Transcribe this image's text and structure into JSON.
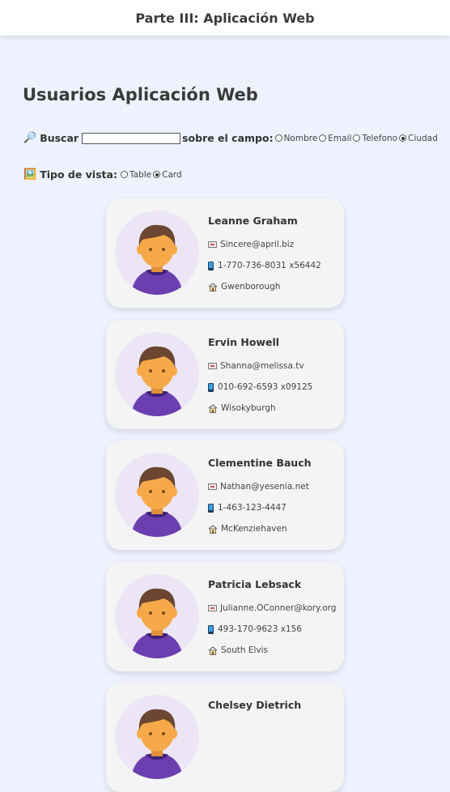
{
  "header": {
    "title": "Parte III: Aplicación Web"
  },
  "main": {
    "title": "Usuarios Aplicación Web"
  },
  "search": {
    "icon": "magnifier-icon",
    "label": "Buscar",
    "value": "",
    "field_label": "sobre el campo:",
    "options": [
      "Nombre",
      "Email",
      "Telefono",
      "Ciudad"
    ],
    "selected": "Ciudad"
  },
  "view": {
    "icon": "picture-icon",
    "label": "Tipo de vista:",
    "options": [
      "Table",
      "Card"
    ],
    "selected": "Card"
  },
  "users": [
    {
      "name": "Leanne Graham",
      "email": "Sincere@april.biz",
      "phone": "1-770-736-8031 x56442",
      "city": "Gwenborough"
    },
    {
      "name": "Ervin Howell",
      "email": "Shanna@melissa.tv",
      "phone": "010-692-6593 x09125",
      "city": "Wisokyburgh"
    },
    {
      "name": "Clementine Bauch",
      "email": "Nathan@yesenia.net",
      "phone": "1-463-123-4447",
      "city": "McKenziehaven"
    },
    {
      "name": "Patricia Lebsack",
      "email": "Julianne.OConner@kory.org",
      "phone": "493-170-9623 x156",
      "city": "South Elvis"
    },
    {
      "name": "Chelsey Dietrich",
      "email": "",
      "phone": "",
      "city": ""
    }
  ],
  "colors": {
    "background": "#eef2ff",
    "card": "#f4f4f4",
    "avatar_bg": "#ebe5f5",
    "shirt": "#6b3fb0",
    "skin": "#f7a94a",
    "hair": "#6b4630"
  }
}
